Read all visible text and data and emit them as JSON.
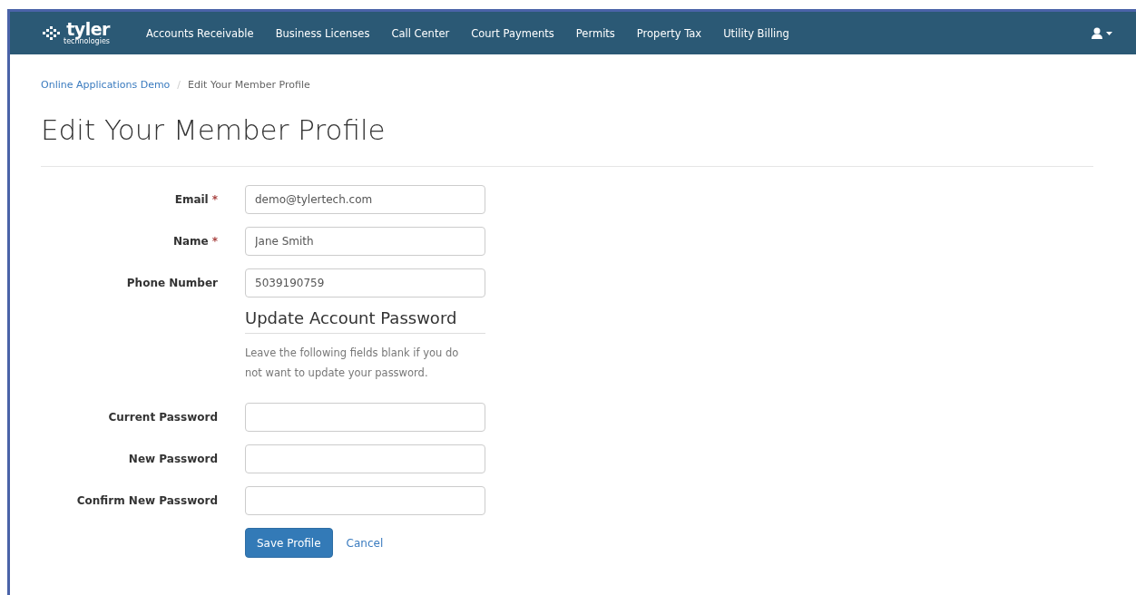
{
  "navbar": {
    "logo": {
      "name": "tyler",
      "tagline": "technologies"
    },
    "items": [
      {
        "label": "Accounts Receivable"
      },
      {
        "label": "Business Licenses"
      },
      {
        "label": "Call Center"
      },
      {
        "label": "Court Payments"
      },
      {
        "label": "Permits"
      },
      {
        "label": "Property Tax"
      },
      {
        "label": "Utility Billing"
      }
    ]
  },
  "breadcrumb": [
    {
      "label": "Online Applications Demo",
      "kind": "link"
    },
    {
      "label": "/",
      "kind": "separator"
    },
    {
      "label": "Edit Your Member Profile",
      "kind": "current"
    }
  ],
  "page_title": "Edit Your Member Profile",
  "profile_fields": [
    {
      "label": "Email",
      "required_mark": "*",
      "value": "demo@tylertech.com"
    },
    {
      "label": "Name",
      "required_mark": "*",
      "value": "Jane Smith"
    },
    {
      "label": "Phone Number",
      "value": "5039190759"
    }
  ],
  "password_section": {
    "heading": "Update Account Password",
    "help": "Leave the following fields blank if you do not want to update your password.",
    "fields": [
      {
        "label": "Current Password"
      },
      {
        "label": "New Password"
      },
      {
        "label": "Confirm New Password"
      }
    ]
  },
  "actions": {
    "save": "Save Profile",
    "cancel": "Cancel"
  }
}
